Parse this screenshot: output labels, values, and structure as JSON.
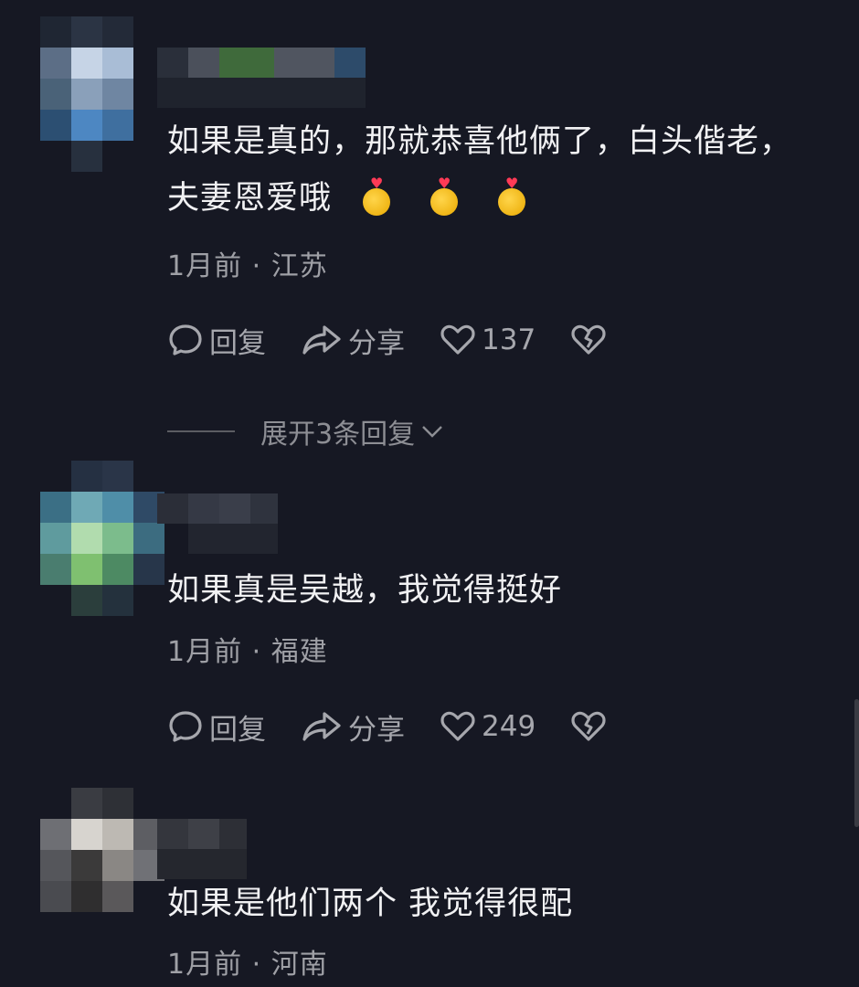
{
  "comments": [
    {
      "text_line1": "如果是真的，那就恭喜他俩了，白头偕老，",
      "text_line2": "夫妻恩爱哦",
      "emojis": [
        "money-bag-heart-emoji",
        "money-bag-heart-emoji",
        "money-bag-heart-emoji"
      ],
      "meta": "1月前 · 江苏",
      "reply_label": "回复",
      "share_label": "分享",
      "like_count": "137",
      "expand_replies": "展开3条回复"
    },
    {
      "text_line1": "如果真是吴越，我觉得挺好",
      "meta": "1月前 · 福建",
      "reply_label": "回复",
      "share_label": "分享",
      "like_count": "249"
    },
    {
      "text_line1": "如果是他们两个 我觉得很配",
      "meta": "1月前 · 河南"
    }
  ],
  "colors": {
    "background": "#161823",
    "text": "#f1f1f3",
    "secondary_text": "#9fa0a6"
  }
}
